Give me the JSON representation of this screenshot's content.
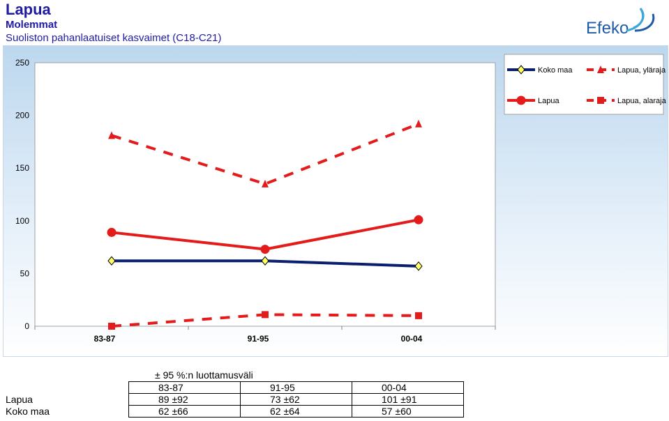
{
  "header": {
    "title": "Lapua",
    "subtitle": "Molemmat",
    "subtitle2": "Suoliston pahanlaatuiset kasvaimet (C18-C21)",
    "logo_text": "Efeko"
  },
  "colors": {
    "title": "#1f1aa6",
    "koko_maa": "#0a1f6e",
    "lapua": "#e31b1b",
    "marker_fill_koko_maa": "#ffff66"
  },
  "chart_data": {
    "type": "line",
    "categories": [
      "83-87",
      "91-95",
      "00-04"
    ],
    "ylim": [
      0,
      250
    ],
    "y_ticks": [
      "0",
      "50",
      "100",
      "150",
      "200",
      "250"
    ],
    "grid": false,
    "legend_position": "top-right",
    "series": [
      {
        "name": "Koko maa",
        "values": [
          62,
          62,
          57
        ],
        "color": "#0a1f6e",
        "marker": "diamond",
        "line": "solid"
      },
      {
        "name": "Lapua",
        "values": [
          89,
          73,
          101
        ],
        "color": "#e31b1b",
        "marker": "circle",
        "line": "solid"
      },
      {
        "name": "Lapua, yläraja",
        "values": [
          181,
          135,
          192
        ],
        "color": "#e31b1b",
        "marker": "triangle",
        "line": "dashed"
      },
      {
        "name": "Lapua, alaraja",
        "values": [
          0,
          11,
          10
        ],
        "color": "#e31b1b",
        "marker": "square",
        "line": "dashed"
      }
    ],
    "legend_order": [
      0,
      2,
      1,
      3
    ]
  },
  "table": {
    "caption": "± 95 %:n luottamusväli",
    "headers": [
      "83-87",
      "91-95",
      "00-04"
    ],
    "rows": [
      {
        "label": "Lapua",
        "cells": [
          "89 ±92",
          "73 ±62",
          "101 ±91"
        ]
      },
      {
        "label": "Koko maa",
        "cells": [
          "62 ±66",
          "62 ±64",
          "57 ±60"
        ]
      }
    ]
  }
}
